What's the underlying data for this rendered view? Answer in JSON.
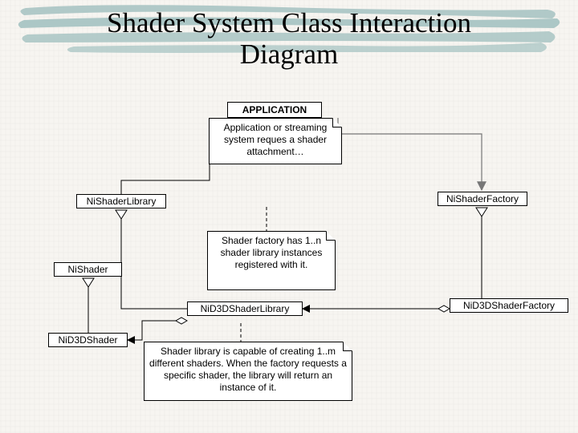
{
  "title_line1": "Shader System Class Interaction",
  "title_line2": "Diagram",
  "classes": {
    "application": "APPLICATION",
    "niShaderLibrary": "NiShaderLibrary",
    "niShaderFactory": "NiShaderFactory",
    "niShader": "NiShader",
    "niD3DShaderLibrary": "NiD3DShaderLibrary",
    "niD3DShaderFactory": "NiD3DShaderFactory",
    "niD3DShader": "NiD3DShader"
  },
  "notes": {
    "appNote": "Application or streaming system reques a shader attachment…",
    "factoryNote": "Shader factory has 1..n shader library instances registered with it.",
    "libraryNote": "Shader library is capable of creating 1..m different shaders. When the factory requests a specific shader, the library will return an instance of it."
  }
}
